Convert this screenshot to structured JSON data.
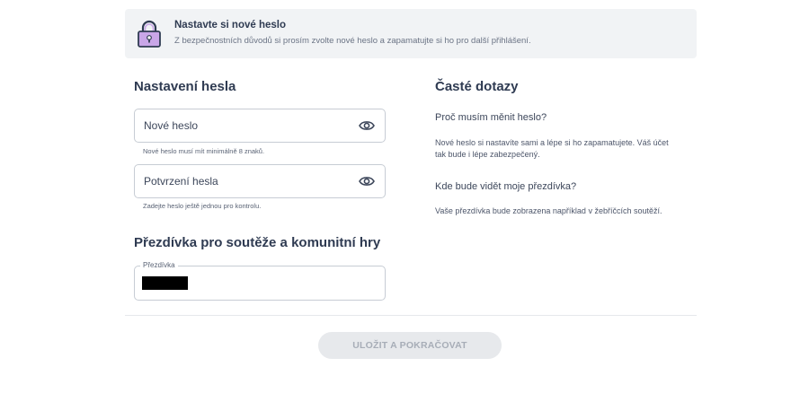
{
  "notice": {
    "icon": "padlock-icon",
    "title": "Nastavte si nové heslo",
    "text": "Z bezpečnostních důvodů si prosím zvolte nové heslo a zapamatujte si ho pro další přihlášení."
  },
  "password_section": {
    "title": "Nastavení hesla",
    "new_password": {
      "placeholder": "Nové heslo",
      "hint": "Nové heslo musí mít minimálně 8 znaků.",
      "icon": "eye-icon"
    },
    "confirm_password": {
      "placeholder": "Potvrzení hesla",
      "hint": "Zadejte heslo ještě jednou pro kontrolu.",
      "icon": "eye-icon"
    }
  },
  "nickname_section": {
    "title": "Přezdívka pro soutěže a komunitní hry",
    "field_label": "Přezdívka",
    "value": ""
  },
  "faq": {
    "title": "Časté dotazy",
    "items": [
      {
        "question": "Proč musím měnit heslo?",
        "answer": "Nové heslo si nastavíte sami a lépe si ho zapamatujete. Váš účet tak bude i lépe zabezpečený."
      },
      {
        "question": "Kde bude vidět moje přezdívka?",
        "answer": "Vaše přezdívka bude zobrazena například v žebříčcích soutěží."
      }
    ]
  },
  "submit_label": "ULOŽIT A POKRAČOVAT",
  "colors": {
    "accent_purple": "#c9a6e8",
    "text_dark": "#2f3b52",
    "notice_bg": "#f1f3f5",
    "button_disabled_bg": "#e7e9ec"
  }
}
